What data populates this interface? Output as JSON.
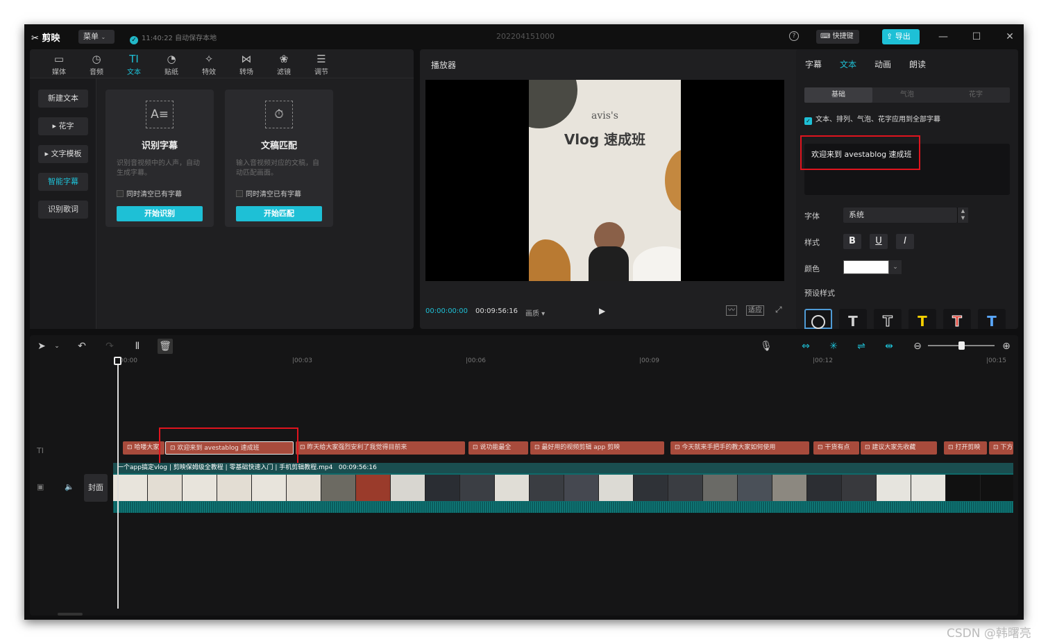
{
  "app": {
    "logo": "剪映",
    "menu_label": "菜单",
    "save_status": "11:40:22 自动保存本地",
    "project_title": "202204151000",
    "help": "?",
    "shortcut_label": "快捷键",
    "export_label": "导出"
  },
  "media_tabs": [
    {
      "label": "媒体",
      "icon": "media-icon",
      "glyph": "▭"
    },
    {
      "label": "音频",
      "icon": "audio-icon",
      "glyph": "◷"
    },
    {
      "label": "文本",
      "icon": "text-icon",
      "glyph": "TI"
    },
    {
      "label": "贴纸",
      "icon": "sticker-icon",
      "glyph": "◔"
    },
    {
      "label": "特效",
      "icon": "effects-icon",
      "glyph": "✧"
    },
    {
      "label": "转场",
      "icon": "transition-icon",
      "glyph": "⋈"
    },
    {
      "label": "滤镜",
      "icon": "filter-icon",
      "glyph": "❀"
    },
    {
      "label": "调节",
      "icon": "adjust-icon",
      "glyph": "☰"
    }
  ],
  "active_tab": "文本",
  "text_side": [
    "新建文本",
    "▸ 花字",
    "▸ 文字模板",
    "智能字幕",
    "识别歌词"
  ],
  "cards": [
    {
      "title": "识别字幕",
      "desc": "识别音视频中的人声，自动生成字幕。",
      "checkbox": "同时清空已有字幕",
      "button": "开始识别",
      "glyph": "A≡"
    },
    {
      "title": "文稿匹配",
      "desc": "输入音视频对应的文稿，自动匹配画面。",
      "checkbox": "同时清空已有字幕",
      "button": "开始匹配",
      "glyph": "⏱"
    }
  ],
  "player": {
    "title": "播放器",
    "current": "00:00:00:00",
    "total": "00:09:56:16",
    "quality": "画质 ▾",
    "fit": "适应",
    "video_title_1": "avis's",
    "video_title_2": "Vlog 速成班"
  },
  "right_tabs": [
    "字幕",
    "文本",
    "动画",
    "朗读"
  ],
  "right_active": "文本",
  "segments": [
    "基础",
    "气泡",
    "花字"
  ],
  "apply_all": "文本、排列、气泡、花字应用到全部字幕",
  "text_content": "欢迎来到 avestablog 速成班",
  "props": {
    "font_label": "字体",
    "font_value": "系统",
    "style_label": "样式",
    "bold": "B",
    "underline": "U",
    "italic": "I",
    "color_label": "颜色",
    "color_value": "#ffffff",
    "preset_label": "预设样式"
  },
  "presets": [
    {
      "glyph": "⃠",
      "color": "#cccccc"
    },
    {
      "glyph": "T",
      "color": "#ffffff"
    },
    {
      "glyph": "T",
      "color": "#222222"
    },
    {
      "glyph": "T",
      "color": "#f5d000"
    },
    {
      "glyph": "T",
      "color": "#e0453a"
    },
    {
      "glyph": "T",
      "color": "#5aa7ff"
    }
  ],
  "ruler": [
    "00:00",
    "|00:03",
    "|00:06",
    "|00:09",
    "|00:12",
    "|00:15"
  ],
  "tracks": {
    "text_track_icon": "TI",
    "video_icon": "▣",
    "audio_icon": "🔈",
    "cover": "封面"
  },
  "subtitle_clips": [
    "哈喽大家",
    "欢迎来到 avestablog 速成班",
    "昨天给大家强烈安利了我觉得目前来",
    "说功能最全",
    "最好用的视频剪辑 app 剪映",
    "今天就来手把手的教大家如何使用",
    "干货有点",
    "建议大家先收藏",
    "打开剪映",
    "下方"
  ],
  "video_clip": {
    "name": "一个app搞定vlog | 剪映保姆级全教程 | 零基础快速入门 | 手机剪辑教程.mp4",
    "duration": "00:09:56:16"
  },
  "watermark": "CSDN @韩曙亮",
  "colors": {
    "accent": "#1ec0d6",
    "clip": "#a84b3c",
    "video": "#0f6a6a",
    "highlight": "#e0141e"
  }
}
